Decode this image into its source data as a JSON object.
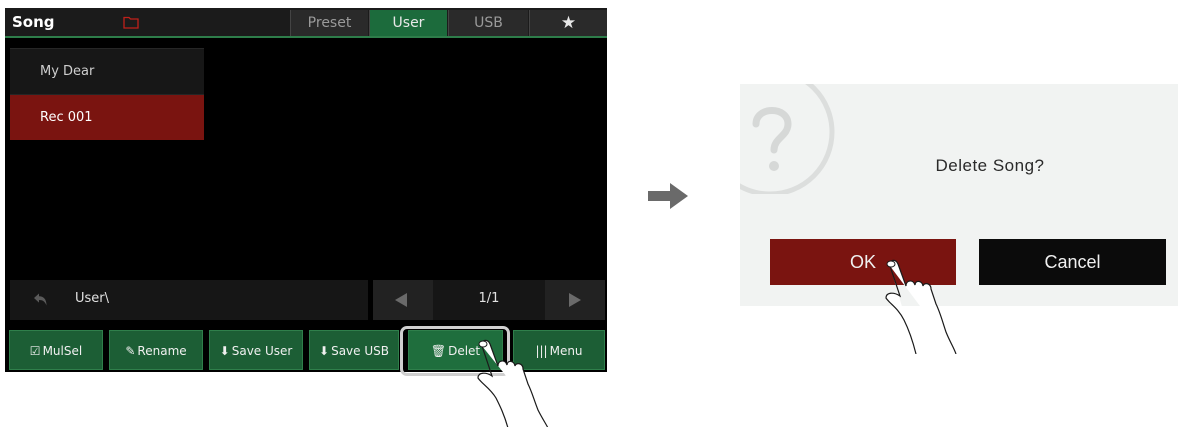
{
  "screen": {
    "title": "Song",
    "tabs": [
      {
        "label": "Preset",
        "active": false
      },
      {
        "label": "User",
        "active": true
      },
      {
        "label": "USB",
        "active": false
      },
      {
        "label": "★",
        "active": false
      }
    ],
    "list": [
      {
        "label": "My Dear",
        "selected": false
      },
      {
        "label": "Rec 001",
        "selected": true
      }
    ],
    "path": "User\\",
    "page": "1/1",
    "buttons": [
      {
        "label": "MulSel",
        "icon": "multi-select-icon"
      },
      {
        "label": "Rename",
        "icon": "rename-icon"
      },
      {
        "label": "Save User",
        "icon": "save-icon"
      },
      {
        "label": "Save USB",
        "icon": "save-usb-icon"
      },
      {
        "label": "Delet",
        "icon": "trash-icon"
      },
      {
        "label": "Menu",
        "icon": "menu-icon"
      }
    ]
  },
  "dialog": {
    "message": "Delete Song?",
    "ok_label": "OK",
    "cancel_label": "Cancel"
  },
  "colors": {
    "green": "#1c5e35",
    "red": "#7a1410",
    "black": "#000000"
  }
}
